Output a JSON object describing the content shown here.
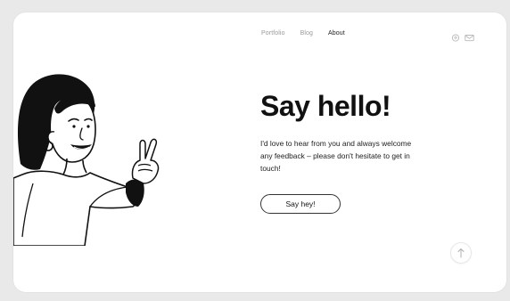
{
  "nav": {
    "items": [
      {
        "label": "Portfolio",
        "active": false
      },
      {
        "label": "Blog",
        "active": false
      },
      {
        "label": "About",
        "active": true
      }
    ]
  },
  "icons": {
    "location": "map-pin-icon",
    "mail": "mail-icon",
    "scroll_top": "arrow-up-icon"
  },
  "hero": {
    "headline": "Say hello!",
    "body": "I'd love to hear from you and always welcome any feedback – please don't hesitate to get in touch!",
    "cta_label": "Say hey!"
  },
  "colors": {
    "accent": "#111111",
    "muted_text": "#9a9a9a",
    "background": "#ffffff"
  }
}
